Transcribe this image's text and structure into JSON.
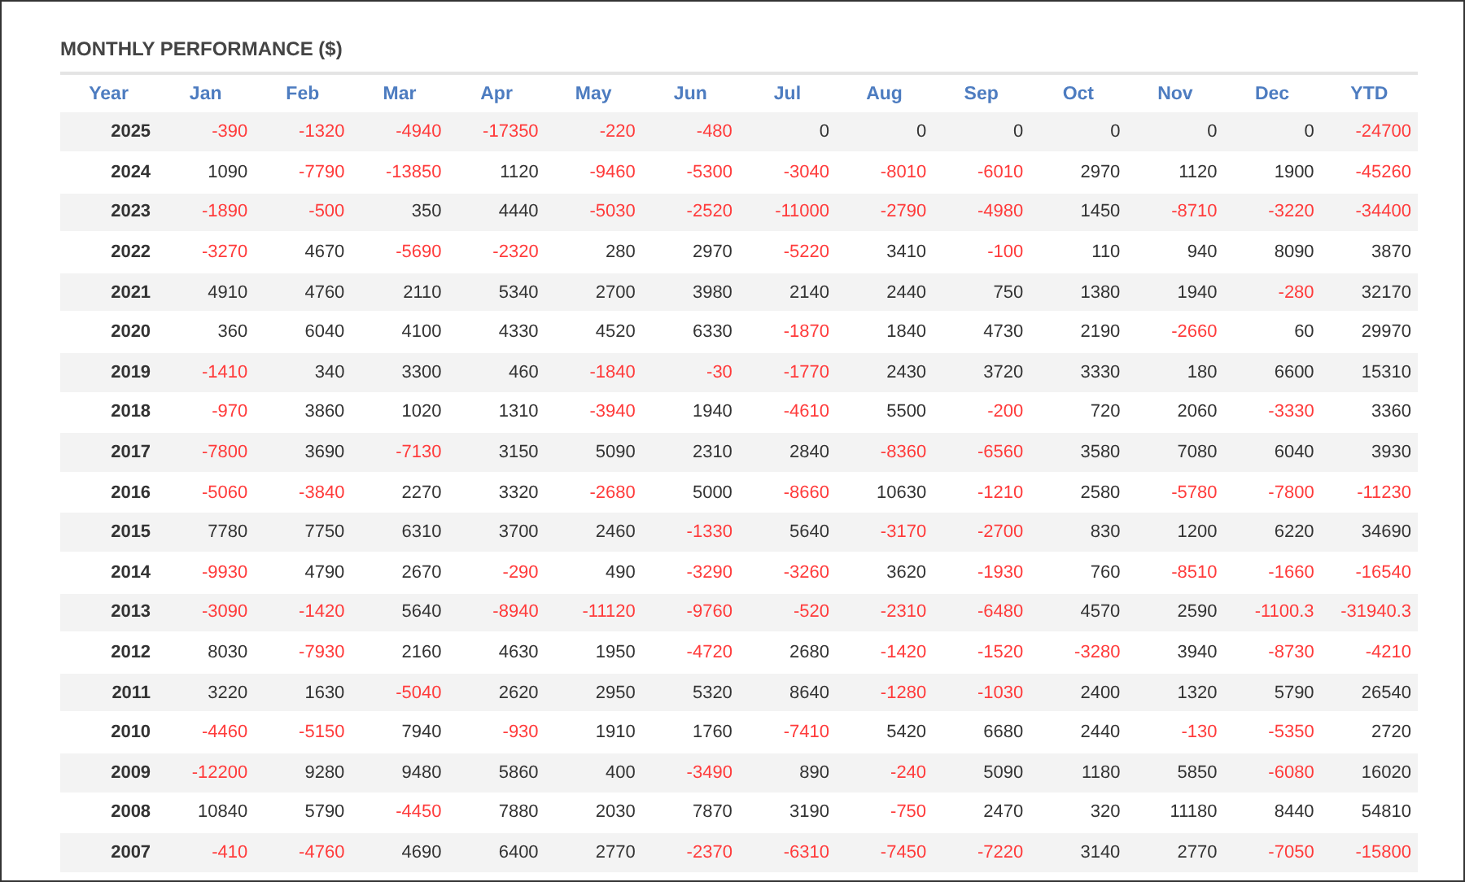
{
  "title": "MONTHLY PERFORMANCE ($)",
  "table": {
    "year_header": "Year",
    "columns": [
      "Jan",
      "Feb",
      "Mar",
      "Apr",
      "May",
      "Jun",
      "Jul",
      "Aug",
      "Sep",
      "Oct",
      "Nov",
      "Dec",
      "YTD"
    ],
    "rows": [
      {
        "year": "2025",
        "cells": [
          {
            "text": "-390",
            "negative": true
          },
          {
            "text": "-1320",
            "negative": true
          },
          {
            "text": "-4940",
            "negative": true
          },
          {
            "text": "-17350",
            "negative": true
          },
          {
            "text": "-220",
            "negative": true
          },
          {
            "text": "-480",
            "negative": true
          },
          {
            "text": "0",
            "negative": false
          },
          {
            "text": "0",
            "negative": false
          },
          {
            "text": "0",
            "negative": false
          },
          {
            "text": "0",
            "negative": false
          },
          {
            "text": "0",
            "negative": false
          },
          {
            "text": "0",
            "negative": false
          },
          {
            "text": "-24700",
            "negative": true
          }
        ]
      },
      {
        "year": "2024",
        "cells": [
          {
            "text": "1090",
            "negative": false
          },
          {
            "text": "-7790",
            "negative": true
          },
          {
            "text": "-13850",
            "negative": true
          },
          {
            "text": "1120",
            "negative": false
          },
          {
            "text": "-9460",
            "negative": true
          },
          {
            "text": "-5300",
            "negative": true
          },
          {
            "text": "-3040",
            "negative": true
          },
          {
            "text": "-8010",
            "negative": true
          },
          {
            "text": "-6010",
            "negative": true
          },
          {
            "text": "2970",
            "negative": false
          },
          {
            "text": "1120",
            "negative": false
          },
          {
            "text": "1900",
            "negative": false
          },
          {
            "text": "-45260",
            "negative": true
          }
        ]
      },
      {
        "year": "2023",
        "cells": [
          {
            "text": "-1890",
            "negative": true
          },
          {
            "text": "-500",
            "negative": true
          },
          {
            "text": "350",
            "negative": false
          },
          {
            "text": "4440",
            "negative": false
          },
          {
            "text": "-5030",
            "negative": true
          },
          {
            "text": "-2520",
            "negative": true
          },
          {
            "text": "-11000",
            "negative": true
          },
          {
            "text": "-2790",
            "negative": true
          },
          {
            "text": "-4980",
            "negative": true
          },
          {
            "text": "1450",
            "negative": false
          },
          {
            "text": "-8710",
            "negative": true
          },
          {
            "text": "-3220",
            "negative": true
          },
          {
            "text": "-34400",
            "negative": true
          }
        ]
      },
      {
        "year": "2022",
        "cells": [
          {
            "text": "-3270",
            "negative": true
          },
          {
            "text": "4670",
            "negative": false
          },
          {
            "text": "-5690",
            "negative": true
          },
          {
            "text": "-2320",
            "negative": true
          },
          {
            "text": "280",
            "negative": false
          },
          {
            "text": "2970",
            "negative": false
          },
          {
            "text": "-5220",
            "negative": true
          },
          {
            "text": "3410",
            "negative": false
          },
          {
            "text": "-100",
            "negative": true
          },
          {
            "text": "110",
            "negative": false
          },
          {
            "text": "940",
            "negative": false
          },
          {
            "text": "8090",
            "negative": false
          },
          {
            "text": "3870",
            "negative": false
          }
        ]
      },
      {
        "year": "2021",
        "cells": [
          {
            "text": "4910",
            "negative": false
          },
          {
            "text": "4760",
            "negative": false
          },
          {
            "text": "2110",
            "negative": false
          },
          {
            "text": "5340",
            "negative": false
          },
          {
            "text": "2700",
            "negative": false
          },
          {
            "text": "3980",
            "negative": false
          },
          {
            "text": "2140",
            "negative": false
          },
          {
            "text": "2440",
            "negative": false
          },
          {
            "text": "750",
            "negative": false
          },
          {
            "text": "1380",
            "negative": false
          },
          {
            "text": "1940",
            "negative": false
          },
          {
            "text": "-280",
            "negative": true
          },
          {
            "text": "32170",
            "negative": false
          }
        ]
      },
      {
        "year": "2020",
        "cells": [
          {
            "text": "360",
            "negative": false
          },
          {
            "text": "6040",
            "negative": false
          },
          {
            "text": "4100",
            "negative": false
          },
          {
            "text": "4330",
            "negative": false
          },
          {
            "text": "4520",
            "negative": false
          },
          {
            "text": "6330",
            "negative": false
          },
          {
            "text": "-1870",
            "negative": true
          },
          {
            "text": "1840",
            "negative": false
          },
          {
            "text": "4730",
            "negative": false
          },
          {
            "text": "2190",
            "negative": false
          },
          {
            "text": "-2660",
            "negative": true
          },
          {
            "text": "60",
            "negative": false
          },
          {
            "text": "29970",
            "negative": false
          }
        ]
      },
      {
        "year": "2019",
        "cells": [
          {
            "text": "-1410",
            "negative": true
          },
          {
            "text": "340",
            "negative": false
          },
          {
            "text": "3300",
            "negative": false
          },
          {
            "text": "460",
            "negative": false
          },
          {
            "text": "-1840",
            "negative": true
          },
          {
            "text": "-30",
            "negative": true
          },
          {
            "text": "-1770",
            "negative": true
          },
          {
            "text": "2430",
            "negative": false
          },
          {
            "text": "3720",
            "negative": false
          },
          {
            "text": "3330",
            "negative": false
          },
          {
            "text": "180",
            "negative": false
          },
          {
            "text": "6600",
            "negative": false
          },
          {
            "text": "15310",
            "negative": false
          }
        ]
      },
      {
        "year": "2018",
        "cells": [
          {
            "text": "-970",
            "negative": true
          },
          {
            "text": "3860",
            "negative": false
          },
          {
            "text": "1020",
            "negative": false
          },
          {
            "text": "1310",
            "negative": false
          },
          {
            "text": "-3940",
            "negative": true
          },
          {
            "text": "1940",
            "negative": false
          },
          {
            "text": "-4610",
            "negative": true
          },
          {
            "text": "5500",
            "negative": false
          },
          {
            "text": "-200",
            "negative": true
          },
          {
            "text": "720",
            "negative": false
          },
          {
            "text": "2060",
            "negative": false
          },
          {
            "text": "-3330",
            "negative": true
          },
          {
            "text": "3360",
            "negative": false
          }
        ]
      },
      {
        "year": "2017",
        "cells": [
          {
            "text": "-7800",
            "negative": true
          },
          {
            "text": "3690",
            "negative": false
          },
          {
            "text": "-7130",
            "negative": true
          },
          {
            "text": "3150",
            "negative": false
          },
          {
            "text": "5090",
            "negative": false
          },
          {
            "text": "2310",
            "negative": false
          },
          {
            "text": "2840",
            "negative": false
          },
          {
            "text": "-8360",
            "negative": true
          },
          {
            "text": "-6560",
            "negative": true
          },
          {
            "text": "3580",
            "negative": false
          },
          {
            "text": "7080",
            "negative": false
          },
          {
            "text": "6040",
            "negative": false
          },
          {
            "text": "3930",
            "negative": false
          }
        ]
      },
      {
        "year": "2016",
        "cells": [
          {
            "text": "-5060",
            "negative": true
          },
          {
            "text": "-3840",
            "negative": true
          },
          {
            "text": "2270",
            "negative": false
          },
          {
            "text": "3320",
            "negative": false
          },
          {
            "text": "-2680",
            "negative": true
          },
          {
            "text": "5000",
            "negative": false
          },
          {
            "text": "-8660",
            "negative": true
          },
          {
            "text": "10630",
            "negative": false
          },
          {
            "text": "-1210",
            "negative": true
          },
          {
            "text": "2580",
            "negative": false
          },
          {
            "text": "-5780",
            "negative": true
          },
          {
            "text": "-7800",
            "negative": true
          },
          {
            "text": "-11230",
            "negative": true
          }
        ]
      },
      {
        "year": "2015",
        "cells": [
          {
            "text": "7780",
            "negative": false
          },
          {
            "text": "7750",
            "negative": false
          },
          {
            "text": "6310",
            "negative": false
          },
          {
            "text": "3700",
            "negative": false
          },
          {
            "text": "2460",
            "negative": false
          },
          {
            "text": "-1330",
            "negative": true
          },
          {
            "text": "5640",
            "negative": false
          },
          {
            "text": "-3170",
            "negative": true
          },
          {
            "text": "-2700",
            "negative": true
          },
          {
            "text": "830",
            "negative": false
          },
          {
            "text": "1200",
            "negative": false
          },
          {
            "text": "6220",
            "negative": false
          },
          {
            "text": "34690",
            "negative": false
          }
        ]
      },
      {
        "year": "2014",
        "cells": [
          {
            "text": "-9930",
            "negative": true
          },
          {
            "text": "4790",
            "negative": false
          },
          {
            "text": "2670",
            "negative": false
          },
          {
            "text": "-290",
            "negative": true
          },
          {
            "text": "490",
            "negative": false
          },
          {
            "text": "-3290",
            "negative": true
          },
          {
            "text": "-3260",
            "negative": true
          },
          {
            "text": "3620",
            "negative": false
          },
          {
            "text": "-1930",
            "negative": true
          },
          {
            "text": "760",
            "negative": false
          },
          {
            "text": "-8510",
            "negative": true
          },
          {
            "text": "-1660",
            "negative": true
          },
          {
            "text": "-16540",
            "negative": true
          }
        ]
      },
      {
        "year": "2013",
        "cells": [
          {
            "text": "-3090",
            "negative": true
          },
          {
            "text": "-1420",
            "negative": true
          },
          {
            "text": "5640",
            "negative": false
          },
          {
            "text": "-8940",
            "negative": true
          },
          {
            "text": "-11120",
            "negative": true
          },
          {
            "text": "-9760",
            "negative": true
          },
          {
            "text": "-520",
            "negative": true
          },
          {
            "text": "-2310",
            "negative": true
          },
          {
            "text": "-6480",
            "negative": true
          },
          {
            "text": "4570",
            "negative": false
          },
          {
            "text": "2590",
            "negative": false
          },
          {
            "text": "-1100.3",
            "negative": true
          },
          {
            "text": "-31940.3",
            "negative": true
          }
        ]
      },
      {
        "year": "2012",
        "cells": [
          {
            "text": "8030",
            "negative": false
          },
          {
            "text": "-7930",
            "negative": true
          },
          {
            "text": "2160",
            "negative": false
          },
          {
            "text": "4630",
            "negative": false
          },
          {
            "text": "1950",
            "negative": false
          },
          {
            "text": "-4720",
            "negative": true
          },
          {
            "text": "2680",
            "negative": false
          },
          {
            "text": "-1420",
            "negative": true
          },
          {
            "text": "-1520",
            "negative": true
          },
          {
            "text": "-3280",
            "negative": true
          },
          {
            "text": "3940",
            "negative": false
          },
          {
            "text": "-8730",
            "negative": true
          },
          {
            "text": "-4210",
            "negative": true
          }
        ]
      },
      {
        "year": "2011",
        "cells": [
          {
            "text": "3220",
            "negative": false
          },
          {
            "text": "1630",
            "negative": false
          },
          {
            "text": "-5040",
            "negative": true
          },
          {
            "text": "2620",
            "negative": false
          },
          {
            "text": "2950",
            "negative": false
          },
          {
            "text": "5320",
            "negative": false
          },
          {
            "text": "8640",
            "negative": false
          },
          {
            "text": "-1280",
            "negative": true
          },
          {
            "text": "-1030",
            "negative": true
          },
          {
            "text": "2400",
            "negative": false
          },
          {
            "text": "1320",
            "negative": false
          },
          {
            "text": "5790",
            "negative": false
          },
          {
            "text": "26540",
            "negative": false
          }
        ]
      },
      {
        "year": "2010",
        "cells": [
          {
            "text": "-4460",
            "negative": true
          },
          {
            "text": "-5150",
            "negative": true
          },
          {
            "text": "7940",
            "negative": false
          },
          {
            "text": "-930",
            "negative": true
          },
          {
            "text": "1910",
            "negative": false
          },
          {
            "text": "1760",
            "negative": false
          },
          {
            "text": "-7410",
            "negative": true
          },
          {
            "text": "5420",
            "negative": false
          },
          {
            "text": "6680",
            "negative": false
          },
          {
            "text": "2440",
            "negative": false
          },
          {
            "text": "-130",
            "negative": true
          },
          {
            "text": "-5350",
            "negative": true
          },
          {
            "text": "2720",
            "negative": false
          }
        ]
      },
      {
        "year": "2009",
        "cells": [
          {
            "text": "-12200",
            "negative": true
          },
          {
            "text": "9280",
            "negative": false
          },
          {
            "text": "9480",
            "negative": false
          },
          {
            "text": "5860",
            "negative": false
          },
          {
            "text": "400",
            "negative": false
          },
          {
            "text": "-3490",
            "negative": true
          },
          {
            "text": "890",
            "negative": false
          },
          {
            "text": "-240",
            "negative": true
          },
          {
            "text": "5090",
            "negative": false
          },
          {
            "text": "1180",
            "negative": false
          },
          {
            "text": "5850",
            "negative": false
          },
          {
            "text": "-6080",
            "negative": true
          },
          {
            "text": "16020",
            "negative": false
          }
        ]
      },
      {
        "year": "2008",
        "cells": [
          {
            "text": "10840",
            "negative": false
          },
          {
            "text": "5790",
            "negative": false
          },
          {
            "text": "-4450",
            "negative": true
          },
          {
            "text": "7880",
            "negative": false
          },
          {
            "text": "2030",
            "negative": false
          },
          {
            "text": "7870",
            "negative": false
          },
          {
            "text": "3190",
            "negative": false
          },
          {
            "text": "-750",
            "negative": true
          },
          {
            "text": "2470",
            "negative": false
          },
          {
            "text": "320",
            "negative": false
          },
          {
            "text": "11180",
            "negative": false
          },
          {
            "text": "8440",
            "negative": false
          },
          {
            "text": "54810",
            "negative": false
          }
        ]
      },
      {
        "year": "2007",
        "cells": [
          {
            "text": "-410",
            "negative": true
          },
          {
            "text": "-4760",
            "negative": true
          },
          {
            "text": "4690",
            "negative": false
          },
          {
            "text": "6400",
            "negative": false
          },
          {
            "text": "2770",
            "negative": false
          },
          {
            "text": "-2370",
            "negative": true
          },
          {
            "text": "-6310",
            "negative": true
          },
          {
            "text": "-7450",
            "negative": true
          },
          {
            "text": "-7220",
            "negative": true
          },
          {
            "text": "3140",
            "negative": false
          },
          {
            "text": "2770",
            "negative": false
          },
          {
            "text": "-7050",
            "negative": true
          },
          {
            "text": "-15800",
            "negative": true
          }
        ]
      }
    ]
  }
}
